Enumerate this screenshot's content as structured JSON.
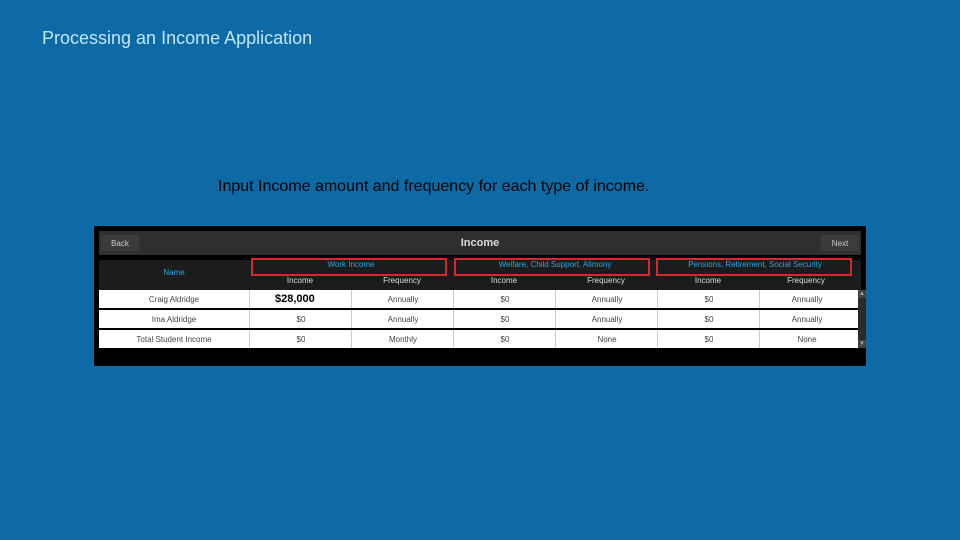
{
  "slide": {
    "title": "Processing an Income Application",
    "instruction": "Input Income amount and frequency for each type of income."
  },
  "panel": {
    "header_title": "Income",
    "back_label": "Back",
    "next_label": "Next",
    "groups": {
      "name": "Name",
      "work": "Work Income",
      "welfare": "Welfare, Child Support, Alimony",
      "pension": "Pensions, Retirement, Social Security"
    },
    "subheaders": {
      "income": "Income",
      "frequency": "Frequency"
    },
    "rows": [
      {
        "name": "Craig Aldridge",
        "work_income": "",
        "work_freq": "Annually",
        "wcs_income": "$0",
        "wcs_freq": "Annually",
        "pen_income": "$0",
        "pen_freq": "Annually"
      },
      {
        "name": "Ima Aldridge",
        "work_income": "$0",
        "work_freq": "Annually",
        "wcs_income": "$0",
        "wcs_freq": "Annually",
        "pen_income": "$0",
        "pen_freq": "Annually"
      },
      {
        "name": "Total Student Income",
        "work_income": "$0",
        "work_freq": "Monthly",
        "wcs_income": "$0",
        "wcs_freq": "None",
        "pen_income": "$0",
        "pen_freq": "None"
      }
    ],
    "overwrite_value": "$28,000"
  },
  "layout": {
    "cols": {
      "name": {
        "l": 0,
        "w": 150
      },
      "wi": {
        "l": 150,
        "w": 102
      },
      "wf": {
        "l": 252,
        "w": 102
      },
      "ci": {
        "l": 354,
        "w": 102
      },
      "cf": {
        "l": 456,
        "w": 102
      },
      "pi": {
        "l": 558,
        "w": 102
      },
      "pf": {
        "l": 660,
        "w": 94
      }
    }
  }
}
